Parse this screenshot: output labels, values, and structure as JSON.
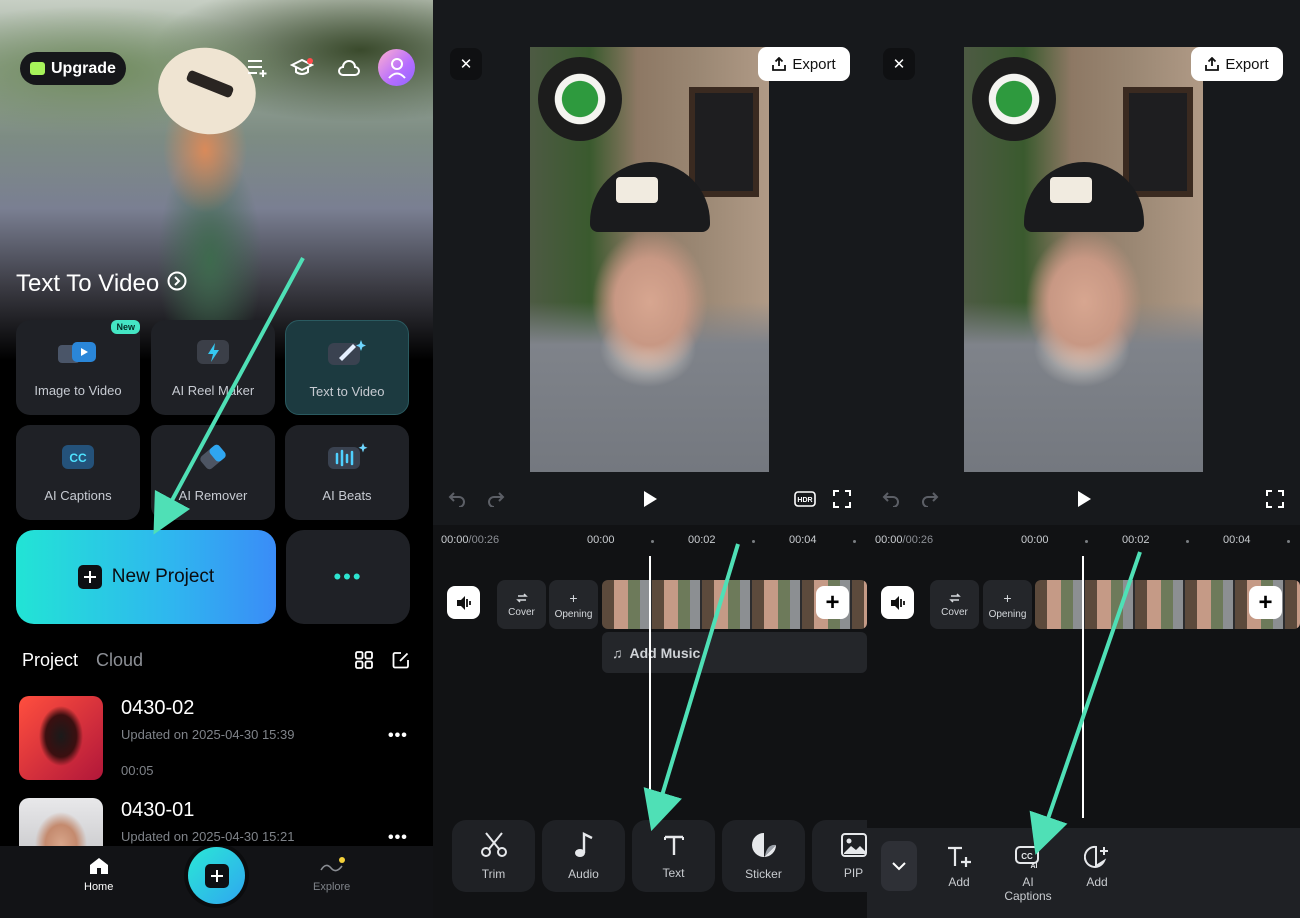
{
  "home": {
    "upgrade_label": "Upgrade",
    "hero_title": "Text To Video",
    "tiles": [
      {
        "label": "Image to Video",
        "badge": "New"
      },
      {
        "label": "AI Reel Maker"
      },
      {
        "label": "Text to Video"
      },
      {
        "label": "AI Captions"
      },
      {
        "label": "AI Remover"
      },
      {
        "label": "AI Beats"
      }
    ],
    "new_project_label": "New Project",
    "more_label": "•••",
    "tabs": {
      "project": "Project",
      "cloud": "Cloud"
    },
    "projects": [
      {
        "name": "0430-02",
        "updated": "Updated on 2025-04-30 15:39",
        "duration": "00:05"
      },
      {
        "name": "0430-01",
        "updated": "Updated on 2025-04-30 15:21"
      }
    ],
    "nav": {
      "home": "Home",
      "explore": "Explore"
    },
    "accent": "#2de4d0"
  },
  "editor1": {
    "export_label": "Export",
    "time_current": "00:00",
    "time_total": "/00:26",
    "ruler": [
      "00:00",
      "00:02",
      "00:04"
    ],
    "cover_label": "Cover",
    "opening_label": "Opening",
    "add_music_label": "Add Music",
    "tools": [
      "Trim",
      "Audio",
      "Text",
      "Sticker",
      "PIP"
    ]
  },
  "editor2": {
    "export_label": "Export",
    "time_current": "00:00",
    "time_total": "/00:26",
    "ruler": [
      "00:00",
      "00:02",
      "00:04"
    ],
    "cover_label": "Cover",
    "opening_label": "Opening",
    "tools": [
      "Add",
      "AI\nCaptions",
      "Add"
    ]
  },
  "annotation_color": "#4fe0b6"
}
